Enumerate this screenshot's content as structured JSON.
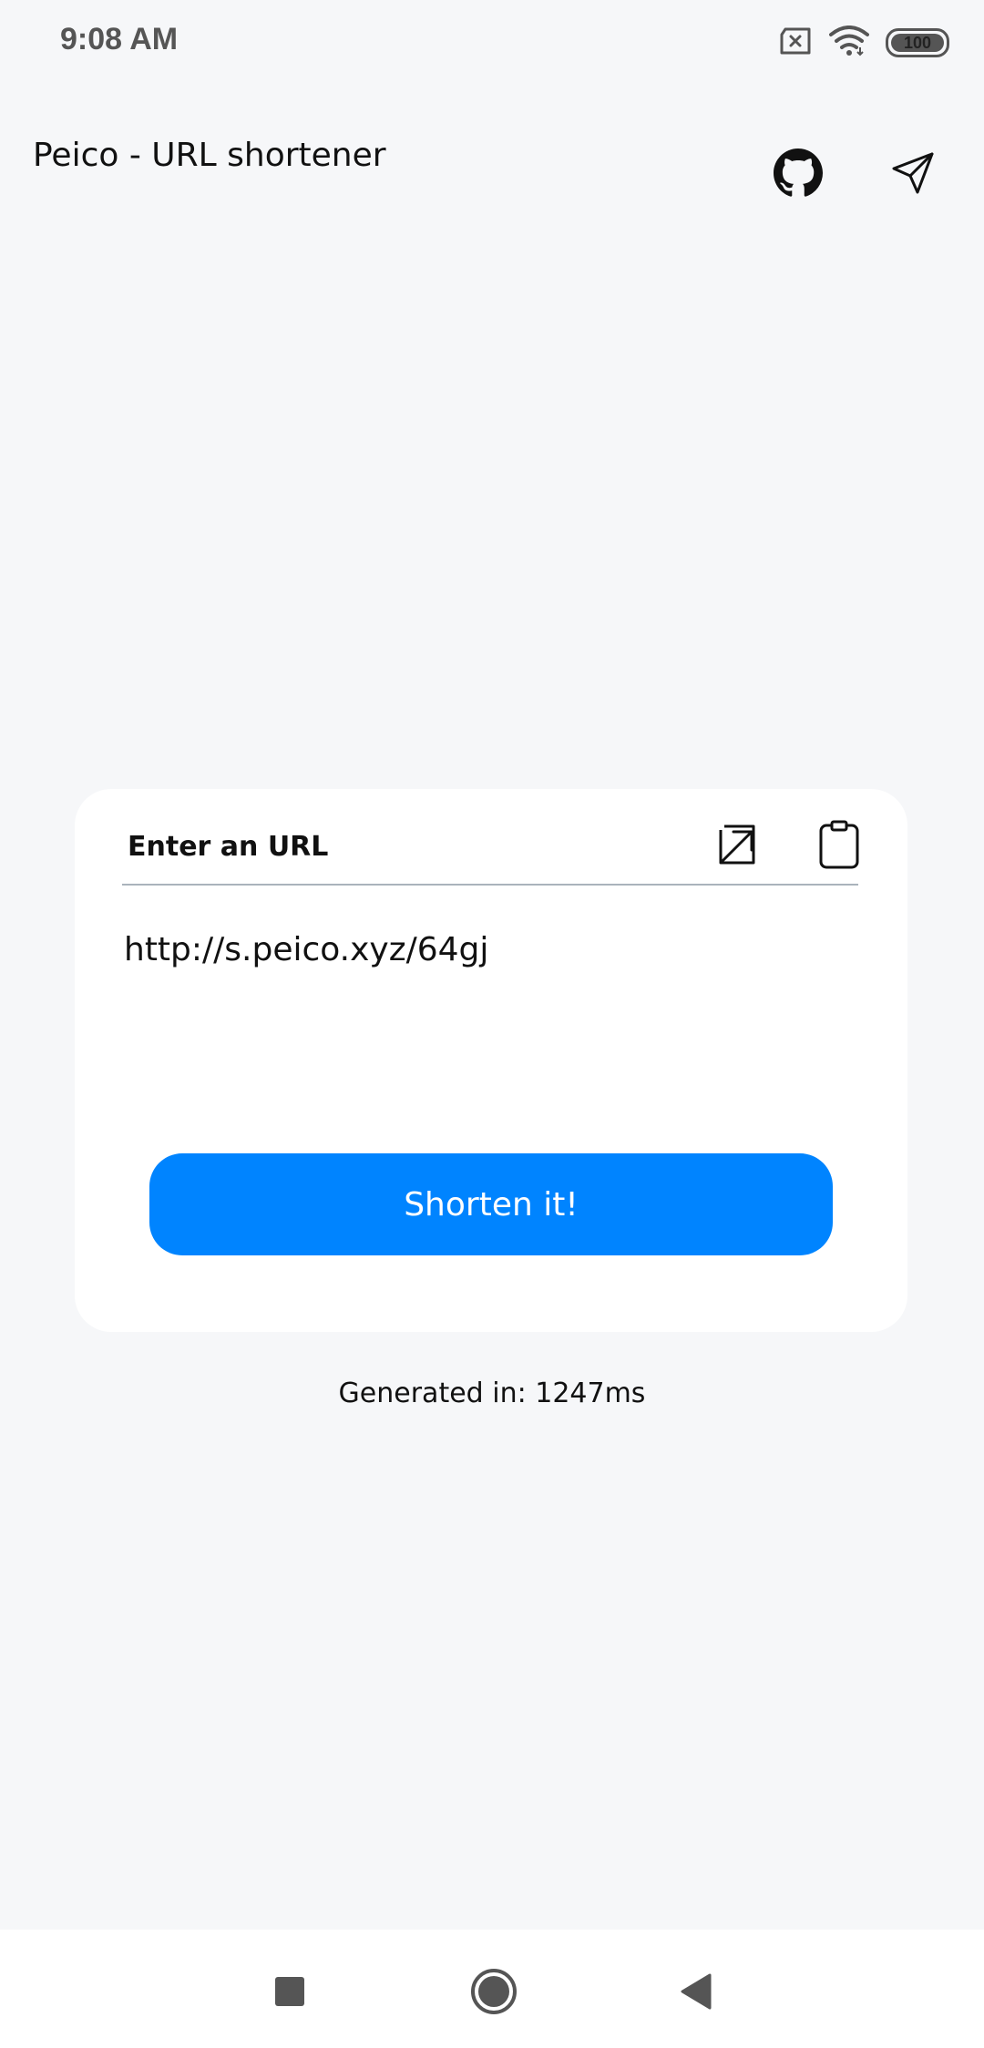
{
  "status_bar": {
    "time": "9:08 AM",
    "battery_level": "100",
    "battery_fraction": 1.0,
    "icons": [
      "sim-error-icon",
      "wifi-icon",
      "battery-icon"
    ]
  },
  "app_bar": {
    "title": "Peico - URL shortener",
    "actions": [
      "github-icon",
      "send-icon"
    ]
  },
  "card": {
    "input_label": "Enter an URL",
    "icons": [
      "open-external-icon",
      "clipboard-icon"
    ],
    "result_url": "http://s.peico.xyz/64gj",
    "button_label": "Shorten it!"
  },
  "footer": {
    "generated_text": "Generated in: 1247ms"
  },
  "nav_bar": {
    "buttons": [
      "recents-icon",
      "home-icon",
      "back-icon"
    ]
  },
  "colors": {
    "accent": "#0084ff",
    "background": "#f6f7f9",
    "card": "#ffffff"
  }
}
